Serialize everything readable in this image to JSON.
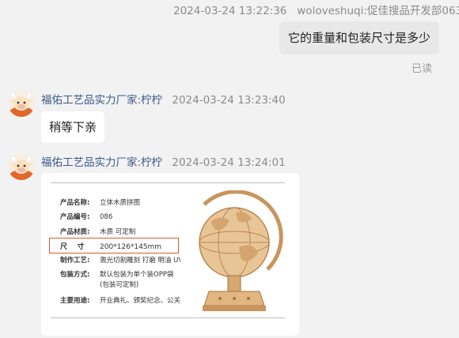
{
  "messages": {
    "outgoing": {
      "timestamp": "2024-03-24 13:22:36",
      "sender": "woloveshuqi:促佳搜品开发部063",
      "text": "它的重量和包装尺寸是多少",
      "status": "已读"
    },
    "reply1": {
      "sender": "福佑工艺品实力厂家:柠柠",
      "timestamp": "2024-03-24 13:23:40",
      "text": "稍等下亲"
    },
    "reply2": {
      "sender": "福佑工艺品实力厂家:柠柠",
      "timestamp": "2024-03-24 13:24:01"
    }
  },
  "product_image": {
    "rows": [
      {
        "key": "产品名称:",
        "value": "立体木质拼图"
      },
      {
        "key": "产品编号:",
        "value": "086"
      },
      {
        "key": "产品材质:",
        "value": "木质 可定制"
      },
      {
        "key": "尺    寸",
        "value": "200*126*145mm"
      },
      {
        "key": "制作工艺:",
        "value": "激光切割雕刻 打磨 明油 UV打印"
      },
      {
        "key": "包装方式:",
        "value": "默认包装为单个装OPP袋"
      },
      {
        "key": "",
        "value": "(包装可定制)"
      },
      {
        "key": "主要用途:",
        "value": "开业典礼、颁奖纪念、公关策划、展销会、广告促销等"
      }
    ]
  },
  "colors": {
    "background": "#f2f2f2",
    "highlight_box": "#e05a2b",
    "sender_name": "#3d5a8a"
  }
}
